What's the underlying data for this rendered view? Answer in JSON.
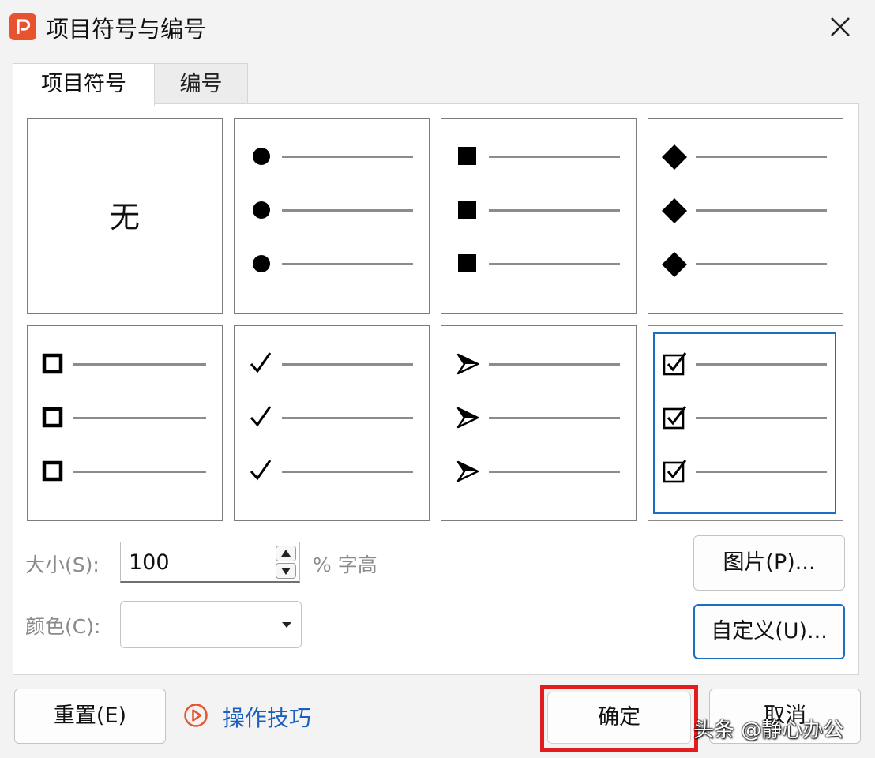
{
  "window": {
    "title": "项目符号与编号",
    "close_icon": "close-icon",
    "app_icon": "wps-presentation-icon"
  },
  "tabs": [
    {
      "label": "项目符号",
      "active": true
    },
    {
      "label": "编号",
      "active": false
    }
  ],
  "bullet_grid": {
    "none_label": "无",
    "options": [
      {
        "name": "none",
        "icon": "none"
      },
      {
        "name": "filled-circle",
        "icon": "filled-circle-icon"
      },
      {
        "name": "filled-square",
        "icon": "filled-square-icon"
      },
      {
        "name": "filled-diamond",
        "icon": "filled-diamond-icon"
      },
      {
        "name": "hollow-square",
        "icon": "hollow-square-icon"
      },
      {
        "name": "checkmark",
        "icon": "checkmark-icon"
      },
      {
        "name": "arrowhead",
        "icon": "arrowhead-icon"
      },
      {
        "name": "checkbox",
        "icon": "checked-box-icon"
      }
    ],
    "selected_index": 7,
    "selection_color": "#1a6fc4"
  },
  "size": {
    "label": "大小(S):",
    "value": "100",
    "unit": "% 字高"
  },
  "color": {
    "label": "颜色(C):",
    "value": ""
  },
  "buttons": {
    "picture": "图片(P)...",
    "custom": "自定义(U)...",
    "reset": "重置(E)",
    "ok": "确定",
    "cancel": "取消"
  },
  "tips": {
    "label": "操作技巧",
    "icon": "play-circle-icon"
  },
  "annotation": {
    "highlight_color": "#e31d1d"
  },
  "watermark": "头条 @静心办公"
}
